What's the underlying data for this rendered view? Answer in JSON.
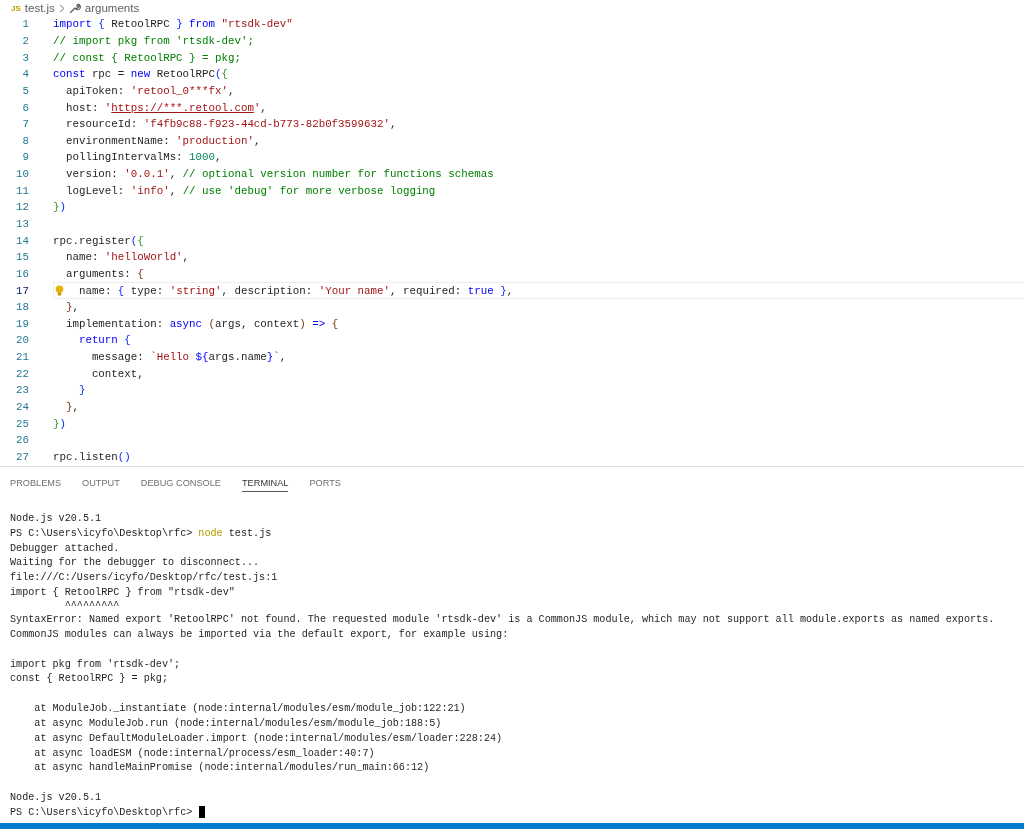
{
  "breadcrumb": {
    "file_badge": "JS",
    "file": "test.js",
    "symbol": "arguments"
  },
  "editor": {
    "lines": [
      {
        "number": "1",
        "current": false,
        "tokens": [
          {
            "kind": "keyword",
            "text": "import "
          },
          {
            "kind": "bracket1",
            "text": "{"
          },
          {
            "kind": "plain",
            "text": " RetoolRPC "
          },
          {
            "kind": "bracket1",
            "text": "} "
          },
          {
            "kind": "keyword",
            "text": "from "
          },
          {
            "kind": "string",
            "text": "\"rtsdk-dev\""
          }
        ]
      },
      {
        "number": "2",
        "current": false,
        "tokens": [
          {
            "kind": "comment",
            "text": "// import pkg from 'rtsdk-dev';"
          }
        ]
      },
      {
        "number": "3",
        "current": false,
        "tokens": [
          {
            "kind": "comment",
            "text": "// const { RetoolRPC } = pkg;"
          }
        ]
      },
      {
        "number": "4",
        "current": false,
        "tokens": [
          {
            "kind": "keyword",
            "text": "const"
          },
          {
            "kind": "plain",
            "text": " rpc = "
          },
          {
            "kind": "keyword",
            "text": "new"
          },
          {
            "kind": "plain",
            "text": " RetoolRPC"
          },
          {
            "kind": "bracket1",
            "text": "("
          },
          {
            "kind": "bracket2",
            "text": "{"
          }
        ]
      },
      {
        "number": "5",
        "current": false,
        "tokens": [
          {
            "kind": "plain",
            "text": "  apiToken: "
          },
          {
            "kind": "string",
            "text": "'retool_0***fx'"
          },
          {
            "kind": "plain",
            "text": ","
          }
        ]
      },
      {
        "number": "6",
        "current": false,
        "tokens": [
          {
            "kind": "plain",
            "text": "  host: "
          },
          {
            "kind": "string",
            "text": "'"
          },
          {
            "kind": "link",
            "text": "https://***.retool.com"
          },
          {
            "kind": "string",
            "text": "'"
          },
          {
            "kind": "plain",
            "text": ","
          }
        ]
      },
      {
        "number": "7",
        "current": false,
        "tokens": [
          {
            "kind": "plain",
            "text": "  resourceId: "
          },
          {
            "kind": "string",
            "text": "'f4fb9c88-f923-44cd-b773-82b0f3599632'"
          },
          {
            "kind": "plain",
            "text": ","
          }
        ]
      },
      {
        "number": "8",
        "current": false,
        "tokens": [
          {
            "kind": "plain",
            "text": "  environmentName: "
          },
          {
            "kind": "string",
            "text": "'production'"
          },
          {
            "kind": "plain",
            "text": ","
          }
        ]
      },
      {
        "number": "9",
        "current": false,
        "tokens": [
          {
            "kind": "plain",
            "text": "  pollingIntervalMs: "
          },
          {
            "kind": "number",
            "text": "1000"
          },
          {
            "kind": "plain",
            "text": ","
          }
        ]
      },
      {
        "number": "10",
        "current": false,
        "tokens": [
          {
            "kind": "plain",
            "text": "  version: "
          },
          {
            "kind": "string",
            "text": "'0.0.1'"
          },
          {
            "kind": "plain",
            "text": ", "
          },
          {
            "kind": "comment",
            "text": "// optional version number for functions schemas"
          }
        ]
      },
      {
        "number": "11",
        "current": false,
        "tokens": [
          {
            "kind": "plain",
            "text": "  logLevel: "
          },
          {
            "kind": "string",
            "text": "'info'"
          },
          {
            "kind": "plain",
            "text": ", "
          },
          {
            "kind": "comment",
            "text": "// use 'debug' for more verbose logging"
          }
        ]
      },
      {
        "number": "12",
        "current": false,
        "tokens": [
          {
            "kind": "bracket2",
            "text": "}"
          },
          {
            "kind": "bracket1",
            "text": ")"
          }
        ]
      },
      {
        "number": "13",
        "current": false
      },
      {
        "number": "14",
        "current": false,
        "tokens": [
          {
            "kind": "plain",
            "text": "rpc.register"
          },
          {
            "kind": "bracket1",
            "text": "("
          },
          {
            "kind": "bracket2",
            "text": "{"
          }
        ]
      },
      {
        "number": "15",
        "current": false,
        "tokens": [
          {
            "kind": "plain",
            "text": "  name: "
          },
          {
            "kind": "string",
            "text": "'helloWorld'"
          },
          {
            "kind": "plain",
            "text": ","
          }
        ]
      },
      {
        "number": "16",
        "current": false,
        "tokens": [
          {
            "kind": "plain",
            "text": "  arguments: "
          },
          {
            "kind": "bracket3",
            "text": "{"
          }
        ]
      },
      {
        "number": "17",
        "current": true,
        "hint": true,
        "tokens": [
          {
            "kind": "plain",
            "text": "  name: "
          },
          {
            "kind": "bracket1",
            "text": "{"
          },
          {
            "kind": "plain",
            "text": " type: "
          },
          {
            "kind": "string",
            "text": "'string'"
          },
          {
            "kind": "plain",
            "text": ", description: "
          },
          {
            "kind": "string",
            "text": "'Your name'"
          },
          {
            "kind": "plain",
            "text": ", required: "
          },
          {
            "kind": "keyword",
            "text": "true "
          },
          {
            "kind": "bracket1",
            "text": "}"
          },
          {
            "kind": "plain",
            "text": ","
          }
        ]
      },
      {
        "number": "18",
        "current": false,
        "tokens": [
          {
            "kind": "bracket3",
            "text": "  }"
          },
          {
            "kind": "plain",
            "text": ","
          }
        ]
      },
      {
        "number": "19",
        "current": false,
        "tokens": [
          {
            "kind": "plain",
            "text": "  implementation: "
          },
          {
            "kind": "keyword",
            "text": "async "
          },
          {
            "kind": "bracket3",
            "text": "("
          },
          {
            "kind": "plain",
            "text": "args, context"
          },
          {
            "kind": "bracket3",
            "text": ") "
          },
          {
            "kind": "keyword",
            "text": "=> "
          },
          {
            "kind": "bracket3",
            "text": "{"
          }
        ]
      },
      {
        "number": "20",
        "current": false,
        "tokens": [
          {
            "kind": "keyword",
            "text": "    return "
          },
          {
            "kind": "bracket1",
            "text": "{"
          }
        ]
      },
      {
        "number": "21",
        "current": false,
        "tokens": [
          {
            "kind": "plain",
            "text": "      message: "
          },
          {
            "kind": "string",
            "text": "`Hello "
          },
          {
            "kind": "keyword",
            "text": "${"
          },
          {
            "kind": "plain",
            "text": "args.name"
          },
          {
            "kind": "keyword",
            "text": "}"
          },
          {
            "kind": "string",
            "text": "`"
          },
          {
            "kind": "plain",
            "text": ","
          }
        ]
      },
      {
        "number": "22",
        "current": false,
        "tokens": [
          {
            "kind": "plain",
            "text": "      context,"
          }
        ]
      },
      {
        "number": "23",
        "current": false,
        "tokens": [
          {
            "kind": "bracket1",
            "text": "    }"
          }
        ]
      },
      {
        "number": "24",
        "current": false,
        "tokens": [
          {
            "kind": "bracket3",
            "text": "  }"
          },
          {
            "kind": "plain",
            "text": ","
          }
        ]
      },
      {
        "number": "25",
        "current": false,
        "tokens": [
          {
            "kind": "bracket2",
            "text": "}"
          },
          {
            "kind": "bracket1",
            "text": ")"
          }
        ]
      },
      {
        "number": "26",
        "current": false
      },
      {
        "number": "27",
        "current": false,
        "tokens": [
          {
            "kind": "plain",
            "text": "rpc.listen"
          },
          {
            "kind": "bracket1",
            "text": "()"
          }
        ]
      }
    ]
  },
  "panel_tabs": [
    {
      "label": "PROBLEMS",
      "selected": false
    },
    {
      "label": "OUTPUT",
      "selected": false
    },
    {
      "label": "DEBUG CONSOLE",
      "selected": false
    },
    {
      "label": "TERMINAL",
      "selected": true
    },
    {
      "label": "PORTS",
      "selected": false
    }
  ],
  "terminal": {
    "lines": [
      {
        "kind": "output",
        "text": "Node.js v20.5.1"
      },
      {
        "kind": "prompt",
        "prompt": "PS C:\\Users\\icyfo\\Desktop\\rfc> ",
        "command": "node",
        "args": " test.js"
      },
      {
        "kind": "output",
        "text": "Debugger attached."
      },
      {
        "kind": "output",
        "text": "Waiting for the debugger to disconnect..."
      },
      {
        "kind": "output",
        "text": "file:///C:/Users/icyfo/Desktop/rfc/test.js:1"
      },
      {
        "kind": "output",
        "text": "import { RetoolRPC } from \"rtsdk-dev\""
      },
      {
        "kind": "marker",
        "text": "         ^^^^^^^^^"
      },
      {
        "kind": "output",
        "text": "SyntaxError: Named export 'RetoolRPC' not found. The requested module 'rtsdk-dev' is a CommonJS module, which may not support all module.exports as named exports."
      },
      {
        "kind": "output",
        "text": "CommonJS modules can always be imported via the default export, for example using:"
      },
      {
        "kind": "blank"
      },
      {
        "kind": "output",
        "text": "import pkg from 'rtsdk-dev';"
      },
      {
        "kind": "output",
        "text": "const { RetoolRPC } = pkg;"
      },
      {
        "kind": "blank"
      },
      {
        "kind": "output",
        "text": "    at ModuleJob._instantiate (node:internal/modules/esm/module_job:122:21)"
      },
      {
        "kind": "output",
        "text": "    at async ModuleJob.run (node:internal/modules/esm/module_job:188:5)"
      },
      {
        "kind": "output",
        "text": "    at async DefaultModuleLoader.import (node:internal/modules/esm/loader:228:24)"
      },
      {
        "kind": "output",
        "text": "    at async loadESM (node:internal/process/esm_loader:40:7)"
      },
      {
        "kind": "output",
        "text": "    at async handleMainPromise (node:internal/modules/run_main:66:12)"
      },
      {
        "kind": "blank"
      },
      {
        "kind": "output",
        "text": "Node.js v20.5.1"
      },
      {
        "kind": "prompt",
        "prompt": "PS C:\\Users\\icyfo\\Desktop\\rfc> ",
        "cursor": true
      }
    ]
  }
}
